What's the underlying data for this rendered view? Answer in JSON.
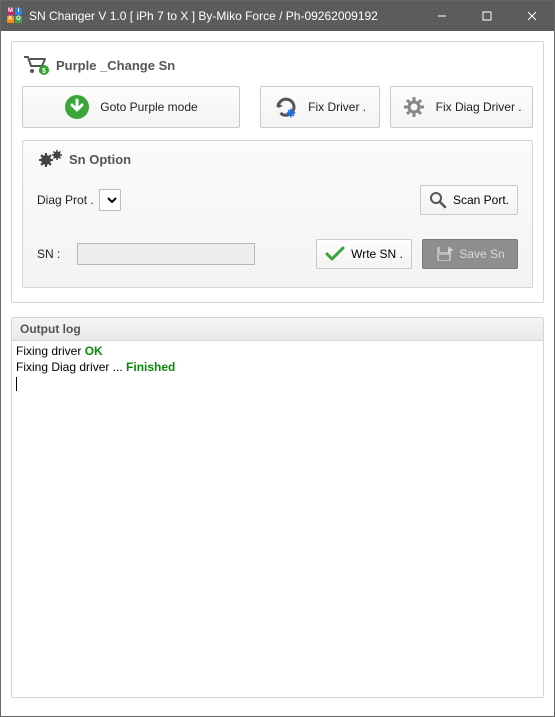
{
  "window": {
    "title": "SN Changer V 1.0  [ iPh 7 to X ] By-Miko Force  / Ph-09262009192"
  },
  "header": {
    "title": "Purple _Change Sn"
  },
  "buttons": {
    "goto_purple": "Goto Purple mode",
    "fix_driver": "Fix Driver .",
    "fix_diag_driver": "Fix Diag Driver .",
    "scan_port": "Scan Port.",
    "write_sn": "Wrte SN .",
    "save_sn": "Save Sn"
  },
  "groupbox": {
    "title": "Sn Option",
    "diag_label": "Diag Prot .",
    "sn_label": "SN :",
    "diag_value": "",
    "sn_value": ""
  },
  "output": {
    "title": "Output log",
    "lines": {
      "l1a": "Fixing driver ",
      "l1b": "OK",
      "l2a": "Fixing Diag driver ... ",
      "l2b": "Finished"
    }
  },
  "colors": {
    "titlebar": "#5c5c5c",
    "accent_green": "#43a047",
    "ok_green": "#0a8a0a"
  }
}
